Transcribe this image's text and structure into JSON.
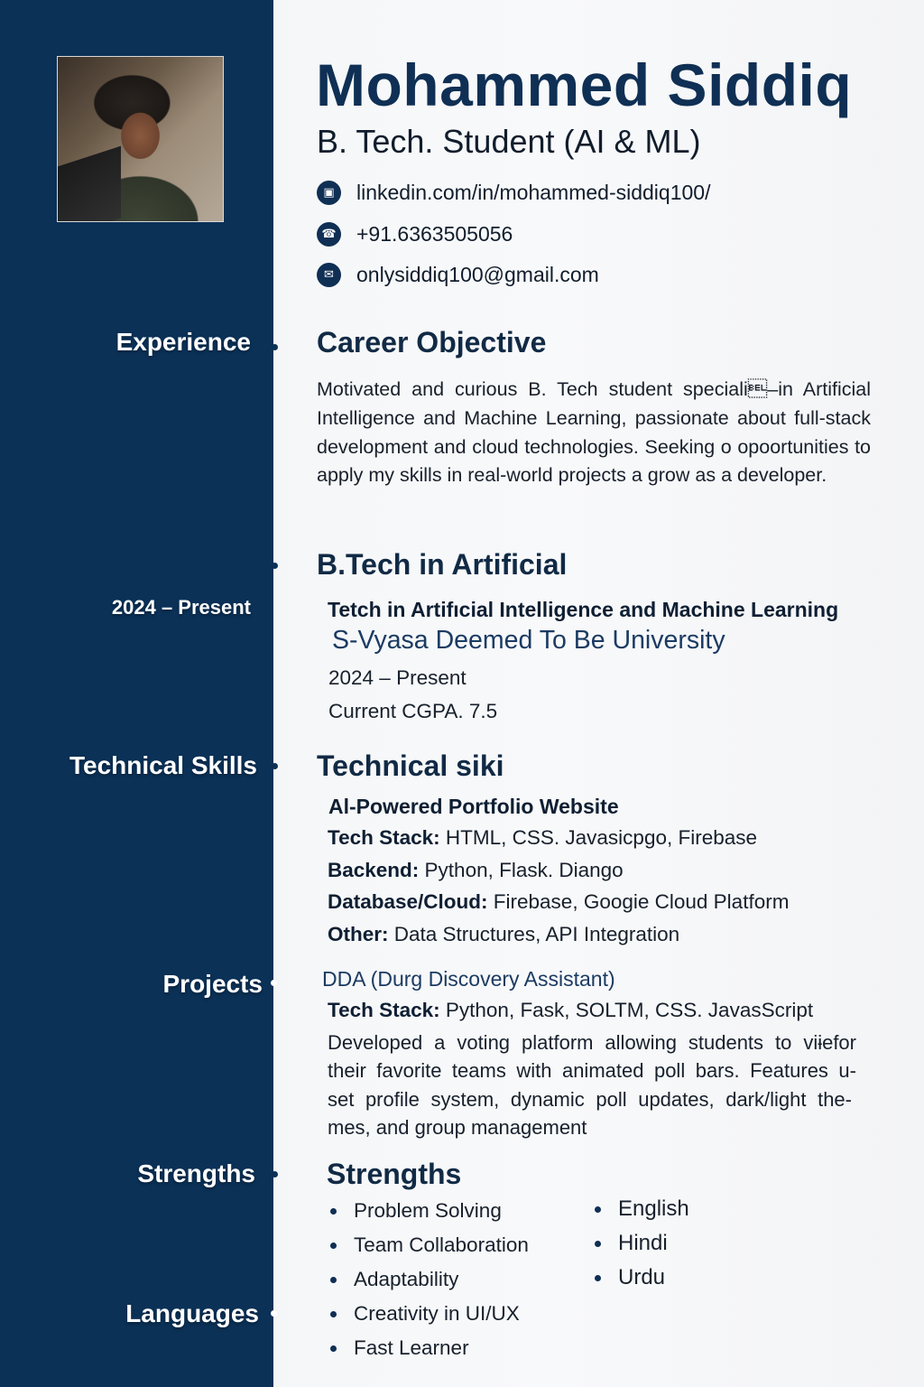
{
  "header": {
    "name": "Mohammed Siddiq",
    "role": "B. Tech. Student (AI & ML)"
  },
  "contact": [
    {
      "icon": "linkedin-icon",
      "glyph": "▣",
      "text": "linkedin.com/in/mohammed-siddiq100/"
    },
    {
      "icon": "phone-icon",
      "glyph": "☎",
      "text": "+91.6363505056"
    },
    {
      "icon": "email-icon",
      "glyph": "✉",
      "text": "onlysiddiq100@gmail.com"
    }
  ],
  "sidebar": {
    "experience": "Experience",
    "date": "2024 – Present",
    "technical_skills": "Technical Skills",
    "projects": "Projects",
    "strengths": "Strengths",
    "languages": "Languages"
  },
  "objective": {
    "title": "Career Objective",
    "text": "Motivated and curious B. Tech student speciali\u0007–in Artificial Intelligence and Machine Learning, passionate about full-stack development and cloud technologies. Seeking o opoortunities to apply my skills in real-world projects a grow as a developer."
  },
  "education": {
    "title": "B.Tech in Artificial",
    "degree": "Tetch in Artifıcial Intelligence and Machine Learning",
    "university": "S-Vyasa Deemed To Be University",
    "period": "2024 – Present",
    "cgpa": "Current CGPA. 7.5"
  },
  "skills": {
    "title": "Technical siki",
    "subtitle": "Al-Powered Portfolio Website",
    "rows": [
      {
        "label": "Tech Stack:",
        "value": " HTML, CSS. Javasicpgo, Firebase"
      },
      {
        "label": "Backend:",
        "value": " Python, Flask. Diango"
      },
      {
        "label": "Database/Cloud:",
        "value": " Firebase, Googie Cloud Platform"
      },
      {
        "label": "Other:",
        "value": " Data Structures, API Integration"
      }
    ]
  },
  "project": {
    "title": "DDA (Durg Discovery Assistant)",
    "stack_label": "Tech Stack:",
    "stack_value": " Python, Fask, SOLTM, CSS. JavasScript",
    "description_lines": [
      "Developed a voting platform allowing students to viɨefor",
      "their favorite teams with animated poll bars. Features u-",
      "set profile system, dynamic poll updates, dark/light the-",
      "mes, and group management"
    ]
  },
  "strengths": {
    "title": "Strengths",
    "items": [
      "Problem Solving",
      "Team Collaboration",
      "Adaptability",
      "Creativity in UI/UX",
      "Fast Learner"
    ]
  },
  "languages": {
    "items": [
      "English",
      "Hindi",
      "Urdu"
    ]
  },
  "colors": {
    "sidebar": "#0b3157",
    "heading": "#0f2f54",
    "text": "#17202c"
  }
}
